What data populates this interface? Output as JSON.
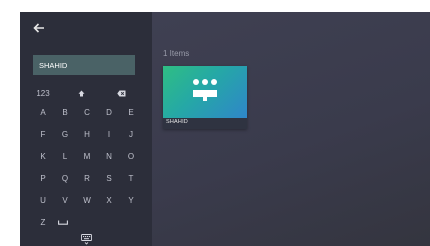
{
  "search": {
    "value": "SHAHID",
    "placeholder": ""
  },
  "keyboard": {
    "rows": [
      [
        "123",
        "⇑",
        "⌫"
      ],
      [
        "A",
        "B",
        "C",
        "D",
        "E"
      ],
      [
        "F",
        "G",
        "H",
        "I",
        "J"
      ],
      [
        "K",
        "L",
        "M",
        "N",
        "O"
      ],
      [
        "P",
        "Q",
        "R",
        "S",
        "T"
      ],
      [
        "U",
        "V",
        "W",
        "X",
        "Y"
      ],
      [
        "Z",
        "space"
      ]
    ]
  },
  "results": {
    "count_label": "1 Items",
    "items": [
      {
        "title": "SHAHID"
      }
    ]
  },
  "icons": {
    "back": "arrow-left-icon",
    "shift": "shift-icon",
    "backspace": "backspace-icon",
    "space": "space-bar-icon",
    "keyboard_toggle": "keyboard-icon"
  },
  "colors": {
    "panel": "#2c2e3a",
    "search_field": "#4a6266",
    "card_gradient_start": "#2fbe83",
    "card_gradient_end": "#2f86c9"
  }
}
